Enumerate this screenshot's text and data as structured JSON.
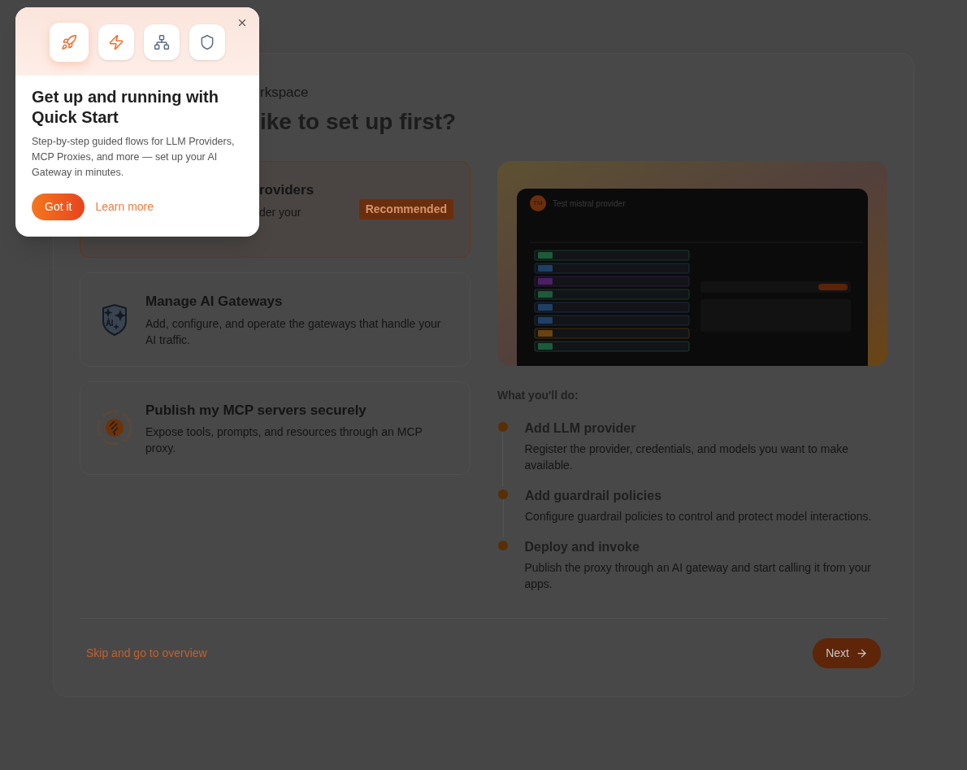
{
  "wizard": {
    "subtitle_visible": "rkspace",
    "heading_visible": "ike to set up first?",
    "options": [
      {
        "kind": "providers",
        "title": "roviders",
        "description": "der your",
        "badge": "Recommended",
        "selected": true
      },
      {
        "kind": "gateways",
        "title": "Manage AI Gateways",
        "description": "Add, configure, and operate the gateways that handle your AI traffic.",
        "selected": false
      },
      {
        "kind": "mcp",
        "title": "Publish my MCP servers securely",
        "description": "Expose tools, prompts, and resources through an MCP proxy.",
        "selected": false
      }
    ],
    "preview": {
      "avatar": "TM",
      "title": "Test mistral provider"
    },
    "steps_heading": "What you'll do:",
    "steps": [
      {
        "title": "Add LLM provider",
        "description": "Register the provider, credentials, and models you want to make available."
      },
      {
        "title": "Add guardrail policies",
        "description": "Configure guardrail policies to control and protect model interactions."
      },
      {
        "title": "Deploy and invoke",
        "description": "Publish the proxy through an AI gateway and start calling it from your apps."
      }
    ],
    "skip_link": "Skip and go to overview",
    "next_button": "Next"
  },
  "popover": {
    "tiles": [
      {
        "selected": true
      },
      {
        "selected": false
      },
      {
        "selected": false
      },
      {
        "selected": false
      }
    ],
    "title": "Get up and running with Quick Start",
    "description": "Step-by-step guided flows for LLM Providers, MCP Proxies, and more — set up your AI Gateway in minutes.",
    "primary_button": "Got it",
    "secondary_link": "Learn more"
  }
}
